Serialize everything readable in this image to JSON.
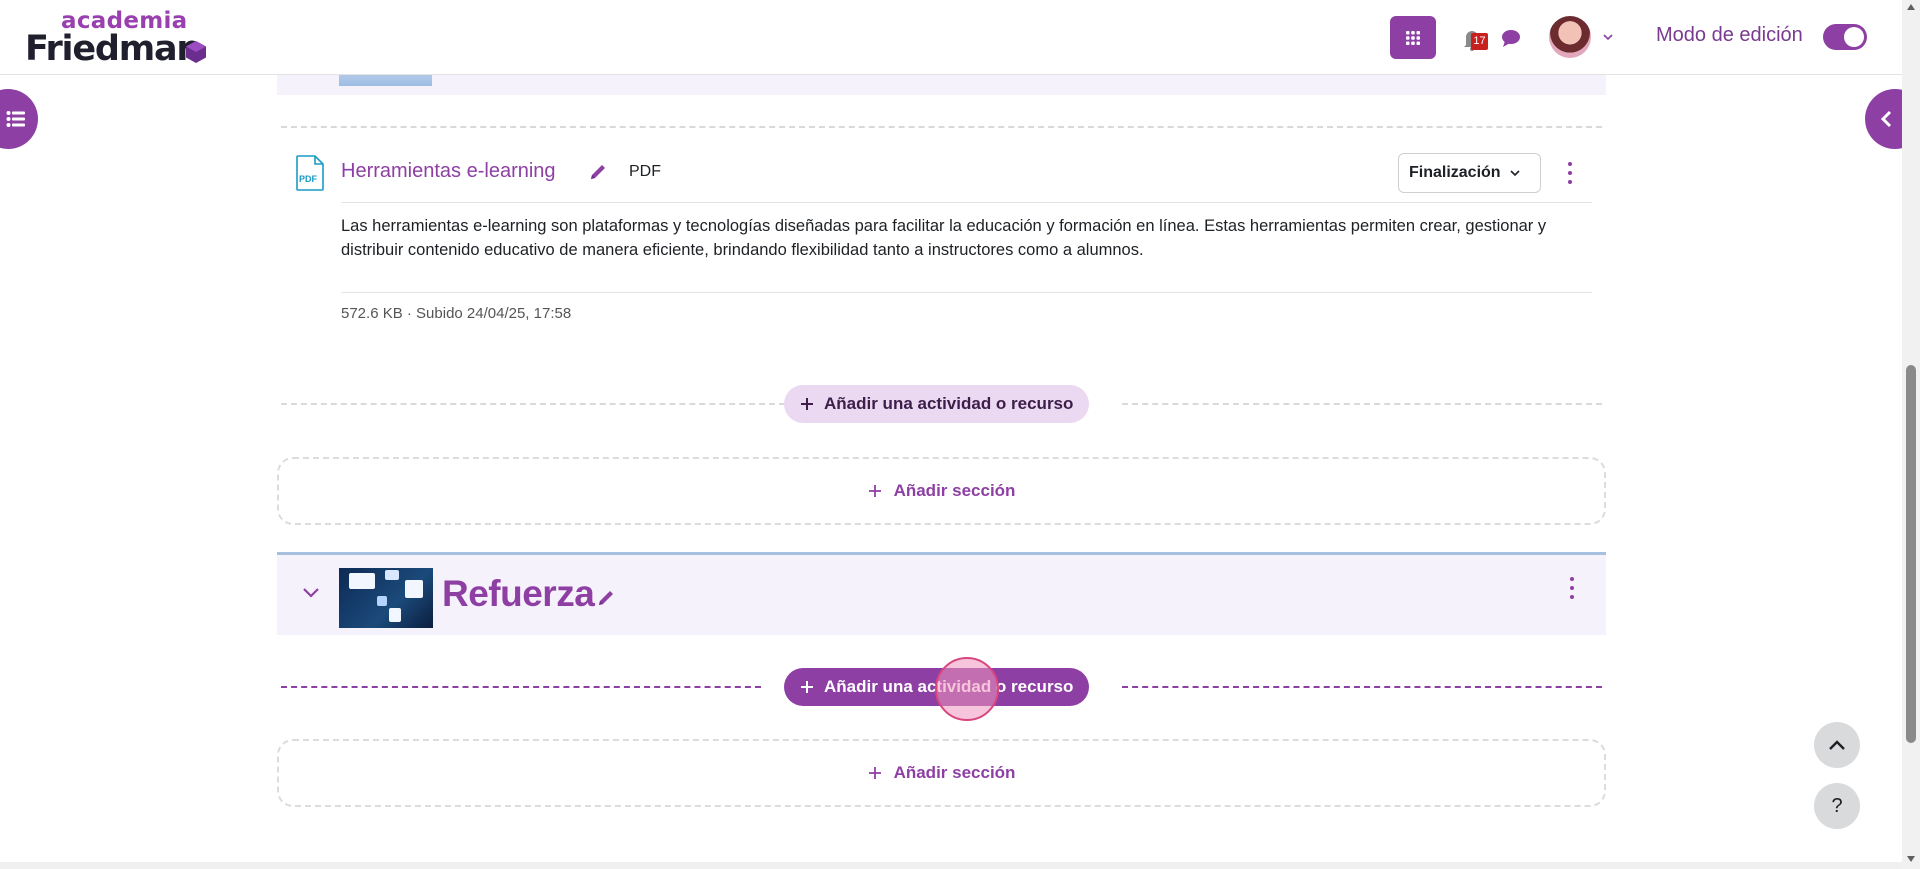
{
  "brand": {
    "top": "academia",
    "bottom": "Friedman",
    "accent_color": "#8e3fa4"
  },
  "navbar": {
    "apps_icon": "grid-icon",
    "notifications_icon": "bell-icon",
    "notifications_count": "17",
    "messages_icon": "chat-bubble-icon",
    "user_menu_icon": "chevron-down-icon",
    "edit_mode_label": "Modo de edición",
    "edit_mode_on": true
  },
  "drawers": {
    "left_icon": "course-index-icon",
    "right_icon": "chevron-left-icon"
  },
  "activity": {
    "title": "Herramientas e-learning",
    "type": "PDF",
    "completion_label": "Finalización",
    "description": "Las herramientas e-learning son plataformas y tecnologías diseñadas para facilitar la educación y formación en línea. Estas herramientas permiten crear, gestionar y distribuir contenido educativo de manera eficiente, brindando flexibilidad tanto a instructores como a alumnos.",
    "meta": "572.6 KB · Subido 24/04/25, 17:58",
    "icon": "pdf-file-icon"
  },
  "actions": {
    "add_activity_label": "Añadir una actividad o recurso",
    "add_section_label": "Añadir sección"
  },
  "section": {
    "title": "Refuerza"
  },
  "floating": {
    "back_to_top_icon": "chevron-up-icon",
    "help_label": "?"
  }
}
